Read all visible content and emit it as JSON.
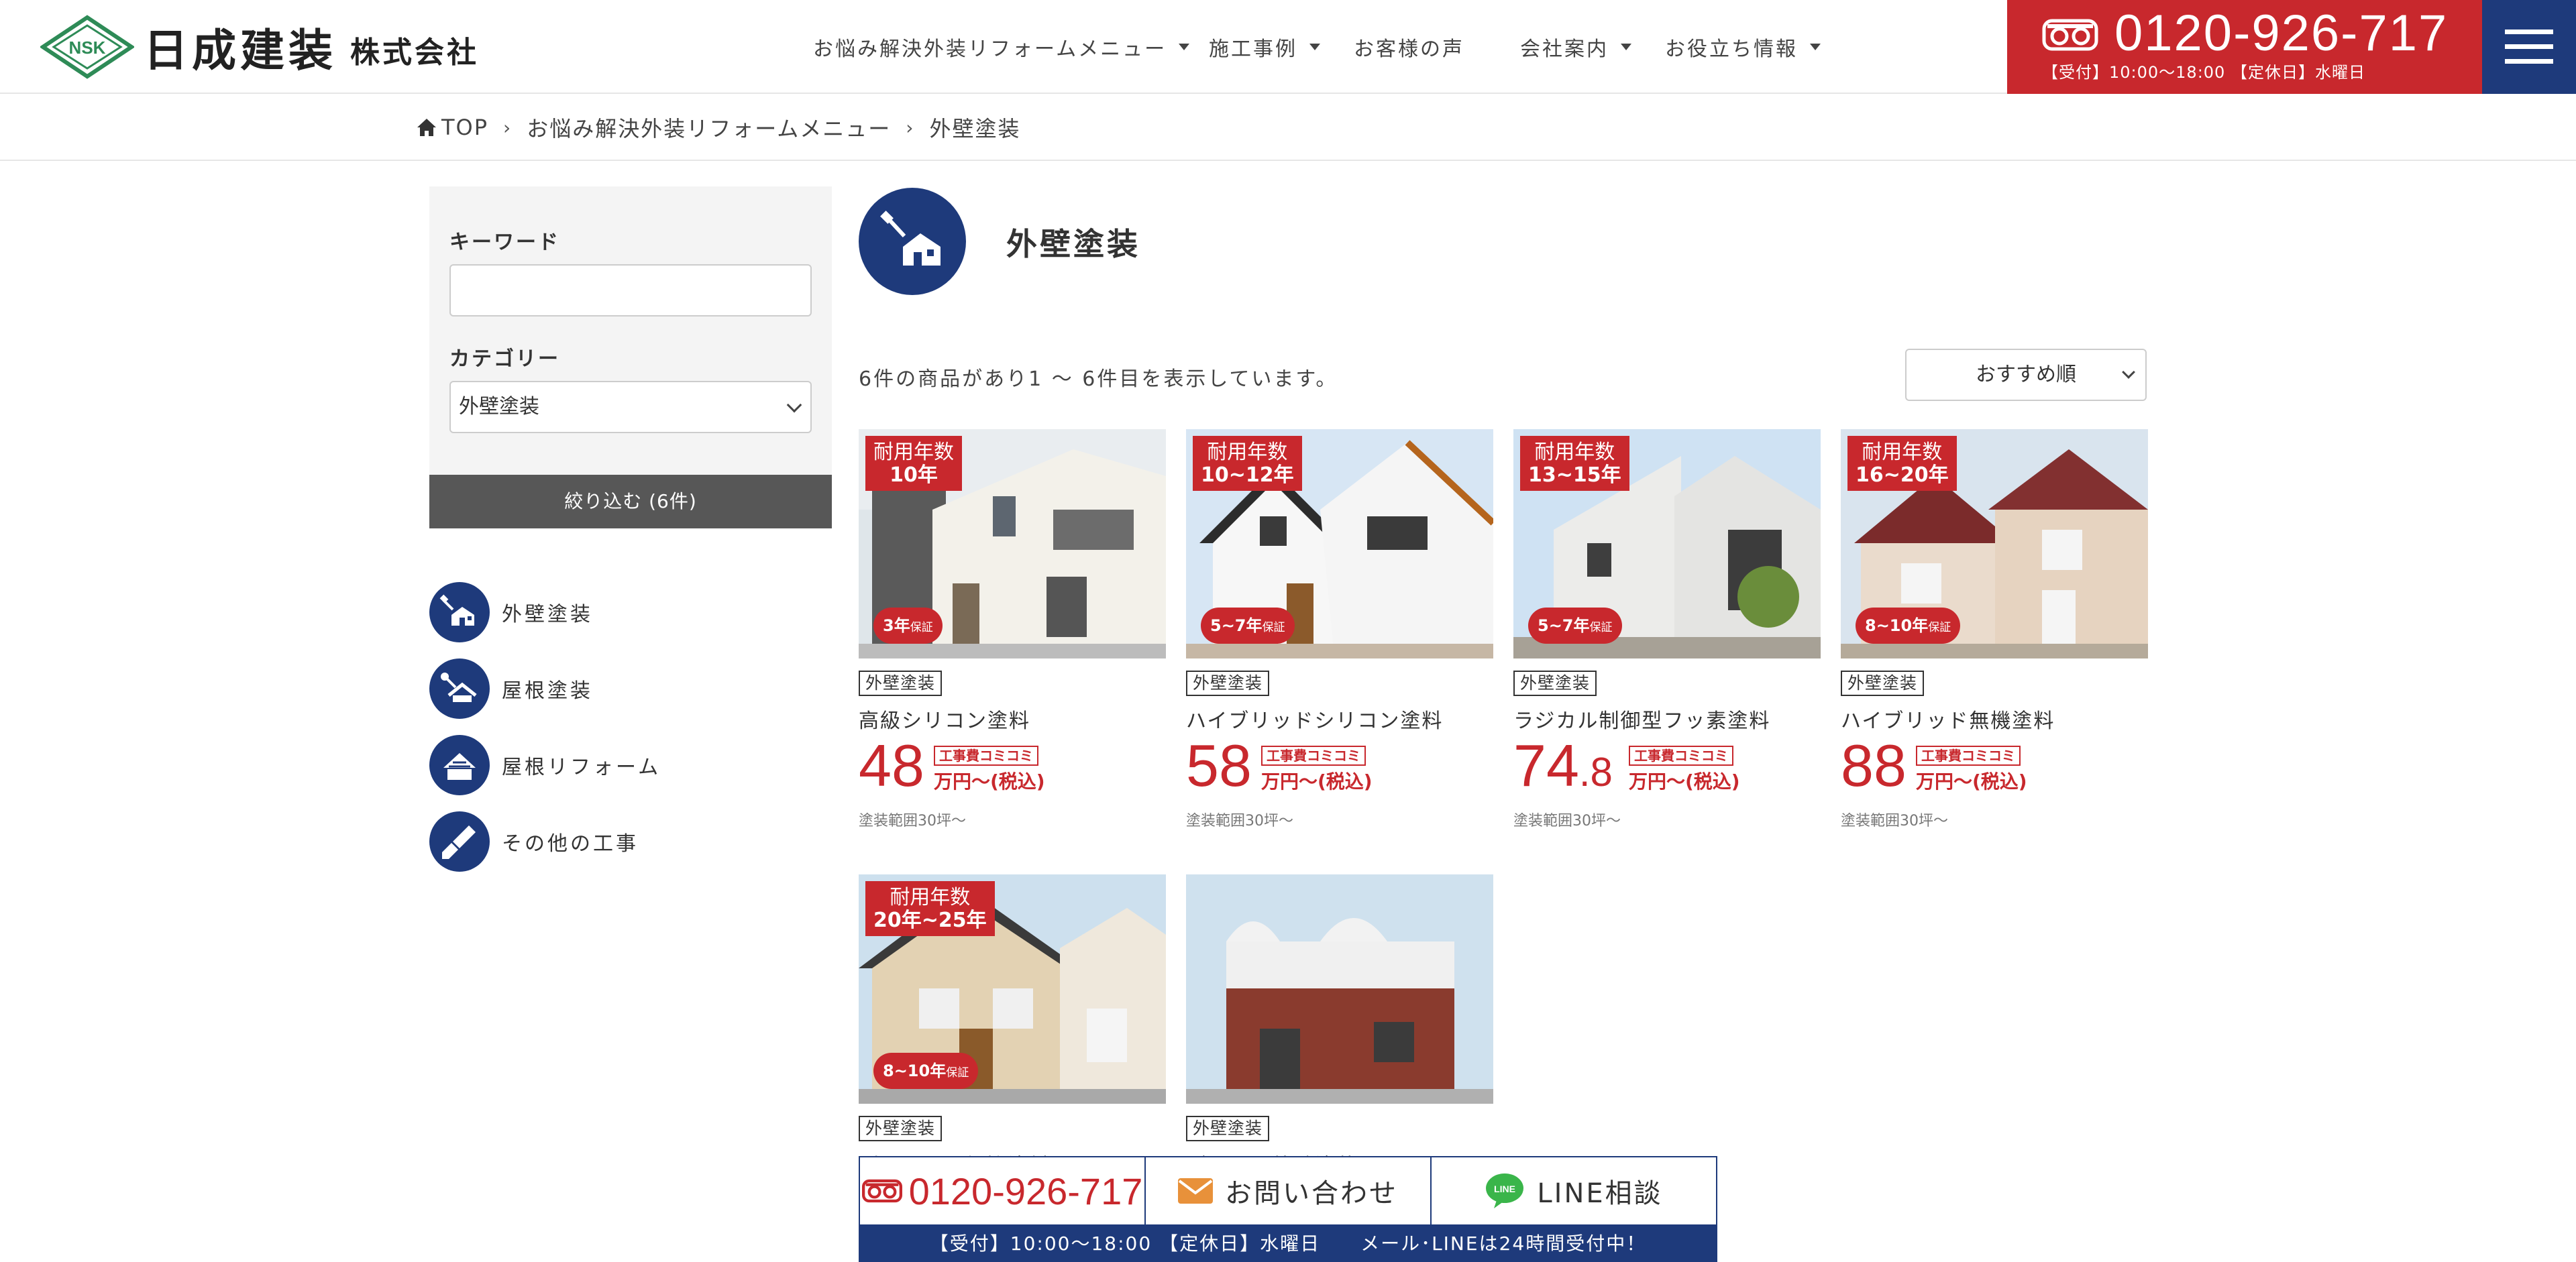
{
  "header": {
    "logo_mark": "NSK",
    "company_name": "日成建装",
    "company_suffix": "株式会社",
    "nav": [
      {
        "label": "お悩み解決外装リフォームメニュー",
        "has_dropdown": true
      },
      {
        "label": "施工事例",
        "has_dropdown": true
      },
      {
        "label": "お客様の声",
        "has_dropdown": false
      },
      {
        "label": "会社案内",
        "has_dropdown": true
      },
      {
        "label": "お役立ち情報",
        "has_dropdown": true
      }
    ],
    "phone": "0120-926-717",
    "hours": "【受付】10:00〜18:00 【定休日】水曜日",
    "menu_icon": "hamburger-icon"
  },
  "breadcrumb": {
    "items": [
      "TOP",
      "お悩み解決外装リフォームメニュー",
      "外壁塗装"
    ]
  },
  "sidebar": {
    "keyword_label": "キーワード",
    "keyword_value": "",
    "category_label": "カテゴリー",
    "category_value": "外壁塗装",
    "filter_button": "絞り込む (6件)",
    "categories": [
      {
        "label": "外壁塗装",
        "icon": "wall-paint-icon"
      },
      {
        "label": "屋根塗装",
        "icon": "roof-paint-icon"
      },
      {
        "label": "屋根リフォーム",
        "icon": "roof-reform-icon"
      },
      {
        "label": "その他の工事",
        "icon": "brush-icon"
      }
    ]
  },
  "main": {
    "title": "外壁塗装",
    "result_count": "6件の商品があり1 〜 6件目を表示しています。",
    "sort": "おすすめ順",
    "products": [
      {
        "dur1": "耐用年数",
        "dur2": "10年",
        "warranty": "3年",
        "warranty_suffix": "保証",
        "tag": "外壁塗装",
        "name": "高級シリコン塗料",
        "price_int": "48",
        "price_dec": "",
        "price_tag": "工事費コミコミ",
        "price_unit": "万円〜(税込)",
        "range": "塗装範囲30坪〜"
      },
      {
        "dur1": "耐用年数",
        "dur2": "10~12年",
        "warranty": "5~7年",
        "warranty_suffix": "保証",
        "tag": "外壁塗装",
        "name": "ハイブリッドシリコン塗料",
        "price_int": "58",
        "price_dec": "",
        "price_tag": "工事費コミコミ",
        "price_unit": "万円〜(税込)",
        "range": "塗装範囲30坪〜"
      },
      {
        "dur1": "耐用年数",
        "dur2": "13~15年",
        "warranty": "5~7年",
        "warranty_suffix": "保証",
        "tag": "外壁塗装",
        "name": "ラジカル制御型フッ素塗料",
        "price_int": "74",
        "price_dec": ".8",
        "price_tag": "工事費コミコミ",
        "price_unit": "万円〜(税込)",
        "range": "塗装範囲30坪〜"
      },
      {
        "dur1": "耐用年数",
        "dur2": "16~20年",
        "warranty": "8~10年",
        "warranty_suffix": "保証",
        "tag": "外壁塗装",
        "name": "ハイブリッド無機塗料",
        "price_int": "88",
        "price_dec": "",
        "price_tag": "工事費コミコミ",
        "price_unit": "万円〜(税込)",
        "range": "塗装範囲30坪〜"
      },
      {
        "dur1": "耐用年数",
        "dur2": "20年~25年",
        "warranty": "8~10年",
        "warranty_suffix": "保証",
        "tag": "外壁塗装",
        "name": "プレミアム無機塗料",
        "price_int": "",
        "price_dec": "",
        "price_tag": "",
        "price_unit": "",
        "range": ""
      },
      {
        "dur1": "",
        "dur2": "",
        "warranty": "",
        "warranty_suffix": "",
        "tag": "外壁塗装",
        "name": "デザイン外壁塗装",
        "price_int": "",
        "price_dec": "",
        "price_tag": "",
        "price_unit": "",
        "range": ""
      }
    ]
  },
  "contact_bar": {
    "phone": "0120-926-717",
    "mail": "お問い合わせ",
    "line": "LINE相談",
    "line_badge": "LINE",
    "note": "【受付】10:00〜18:00 【定休日】水曜日　　メール･LINEは24時間受付中！"
  },
  "colors": {
    "brand_red": "#c8282d",
    "brand_navy": "#1e3a7b",
    "logo_green": "#2e8b57"
  }
}
